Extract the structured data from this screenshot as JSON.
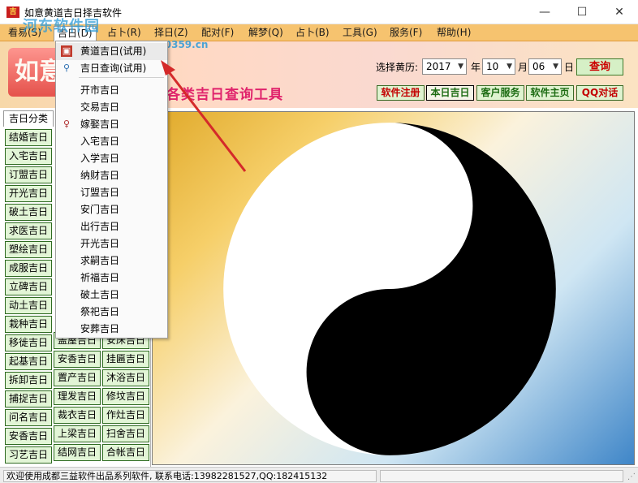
{
  "window": {
    "title": "如意黄道吉日择吉软件",
    "app_icon_text": "吉",
    "min_glyph": "—",
    "max_glyph": "☐",
    "close_glyph": "✕"
  },
  "watermark": {
    "line1": "河东软件园",
    "line2": "www.pc0359.cn"
  },
  "menubar": {
    "items": [
      "看易(S)",
      "吉日(D)",
      "占卜(R)",
      "择日(Z)",
      "配对(F)",
      "解梦(Q)",
      "占卜(B)",
      "工具(G)",
      "服务(F)",
      "帮助(H)"
    ]
  },
  "dropdown": {
    "top_items": [
      "黄道吉日(试用)",
      "吉日查询(试用)"
    ],
    "items": [
      "开市吉日",
      "交易吉日",
      "嫁娶吉日",
      "入宅吉日",
      "入学吉日",
      "纳财吉日",
      "订盟吉日",
      "安门吉日",
      "出行吉日",
      "开光吉日",
      "求嗣吉日",
      "祈福吉日",
      "破土吉日",
      "祭祀吉日",
      "安葬吉日"
    ],
    "icons": [
      "calendar-icon",
      "magnifier-icon",
      "bride-icon"
    ]
  },
  "header": {
    "logo_text": "如意",
    "heading": "各类吉日查询工具",
    "date_label": "选择黄历:",
    "year": "2017",
    "year_unit": "年",
    "month": "10",
    "month_unit": "月",
    "day": "06",
    "day_unit": "日",
    "query_label": "查询",
    "toolbar": [
      "软件注册",
      "本日吉日",
      "客户服务",
      "软件主页",
      "QQ对话"
    ]
  },
  "left_panel": {
    "tab_label": "吉日分类",
    "col1": [
      "结婚吉日",
      "入宅吉日",
      "订盟吉日",
      "开光吉日",
      "破土吉日",
      "求医吉日",
      "塑绘吉日",
      "成服吉日",
      "立碑吉日",
      "动土吉日",
      "栽种吉日",
      "移徙吉日",
      "起基吉日",
      "拆卸吉日",
      "捕捉吉日",
      "问名吉日",
      "安香吉日",
      "习艺吉日"
    ],
    "col2_visible": [
      "盖屋吉日",
      "安香吉日",
      "置产吉日",
      "理发吉日",
      "裁衣吉日",
      "上梁吉日",
      "结网吉日"
    ],
    "col3_visible": [
      "安床吉日",
      "挂匾吉日",
      "沐浴吉日",
      "修坟吉日",
      "作灶吉日",
      "扫舍吉日",
      "合帐吉日"
    ]
  },
  "status": {
    "text": "欢迎使用成都三益软件出品系列软件, 联系电话:13982281527,QQ:182415132",
    "grip": "⋰"
  },
  "colors": {
    "menubar": "#f6c36f",
    "button_bg": "#e2f5d6",
    "heading": "#e0246c",
    "annotation_arrow": "#d42a2a"
  }
}
